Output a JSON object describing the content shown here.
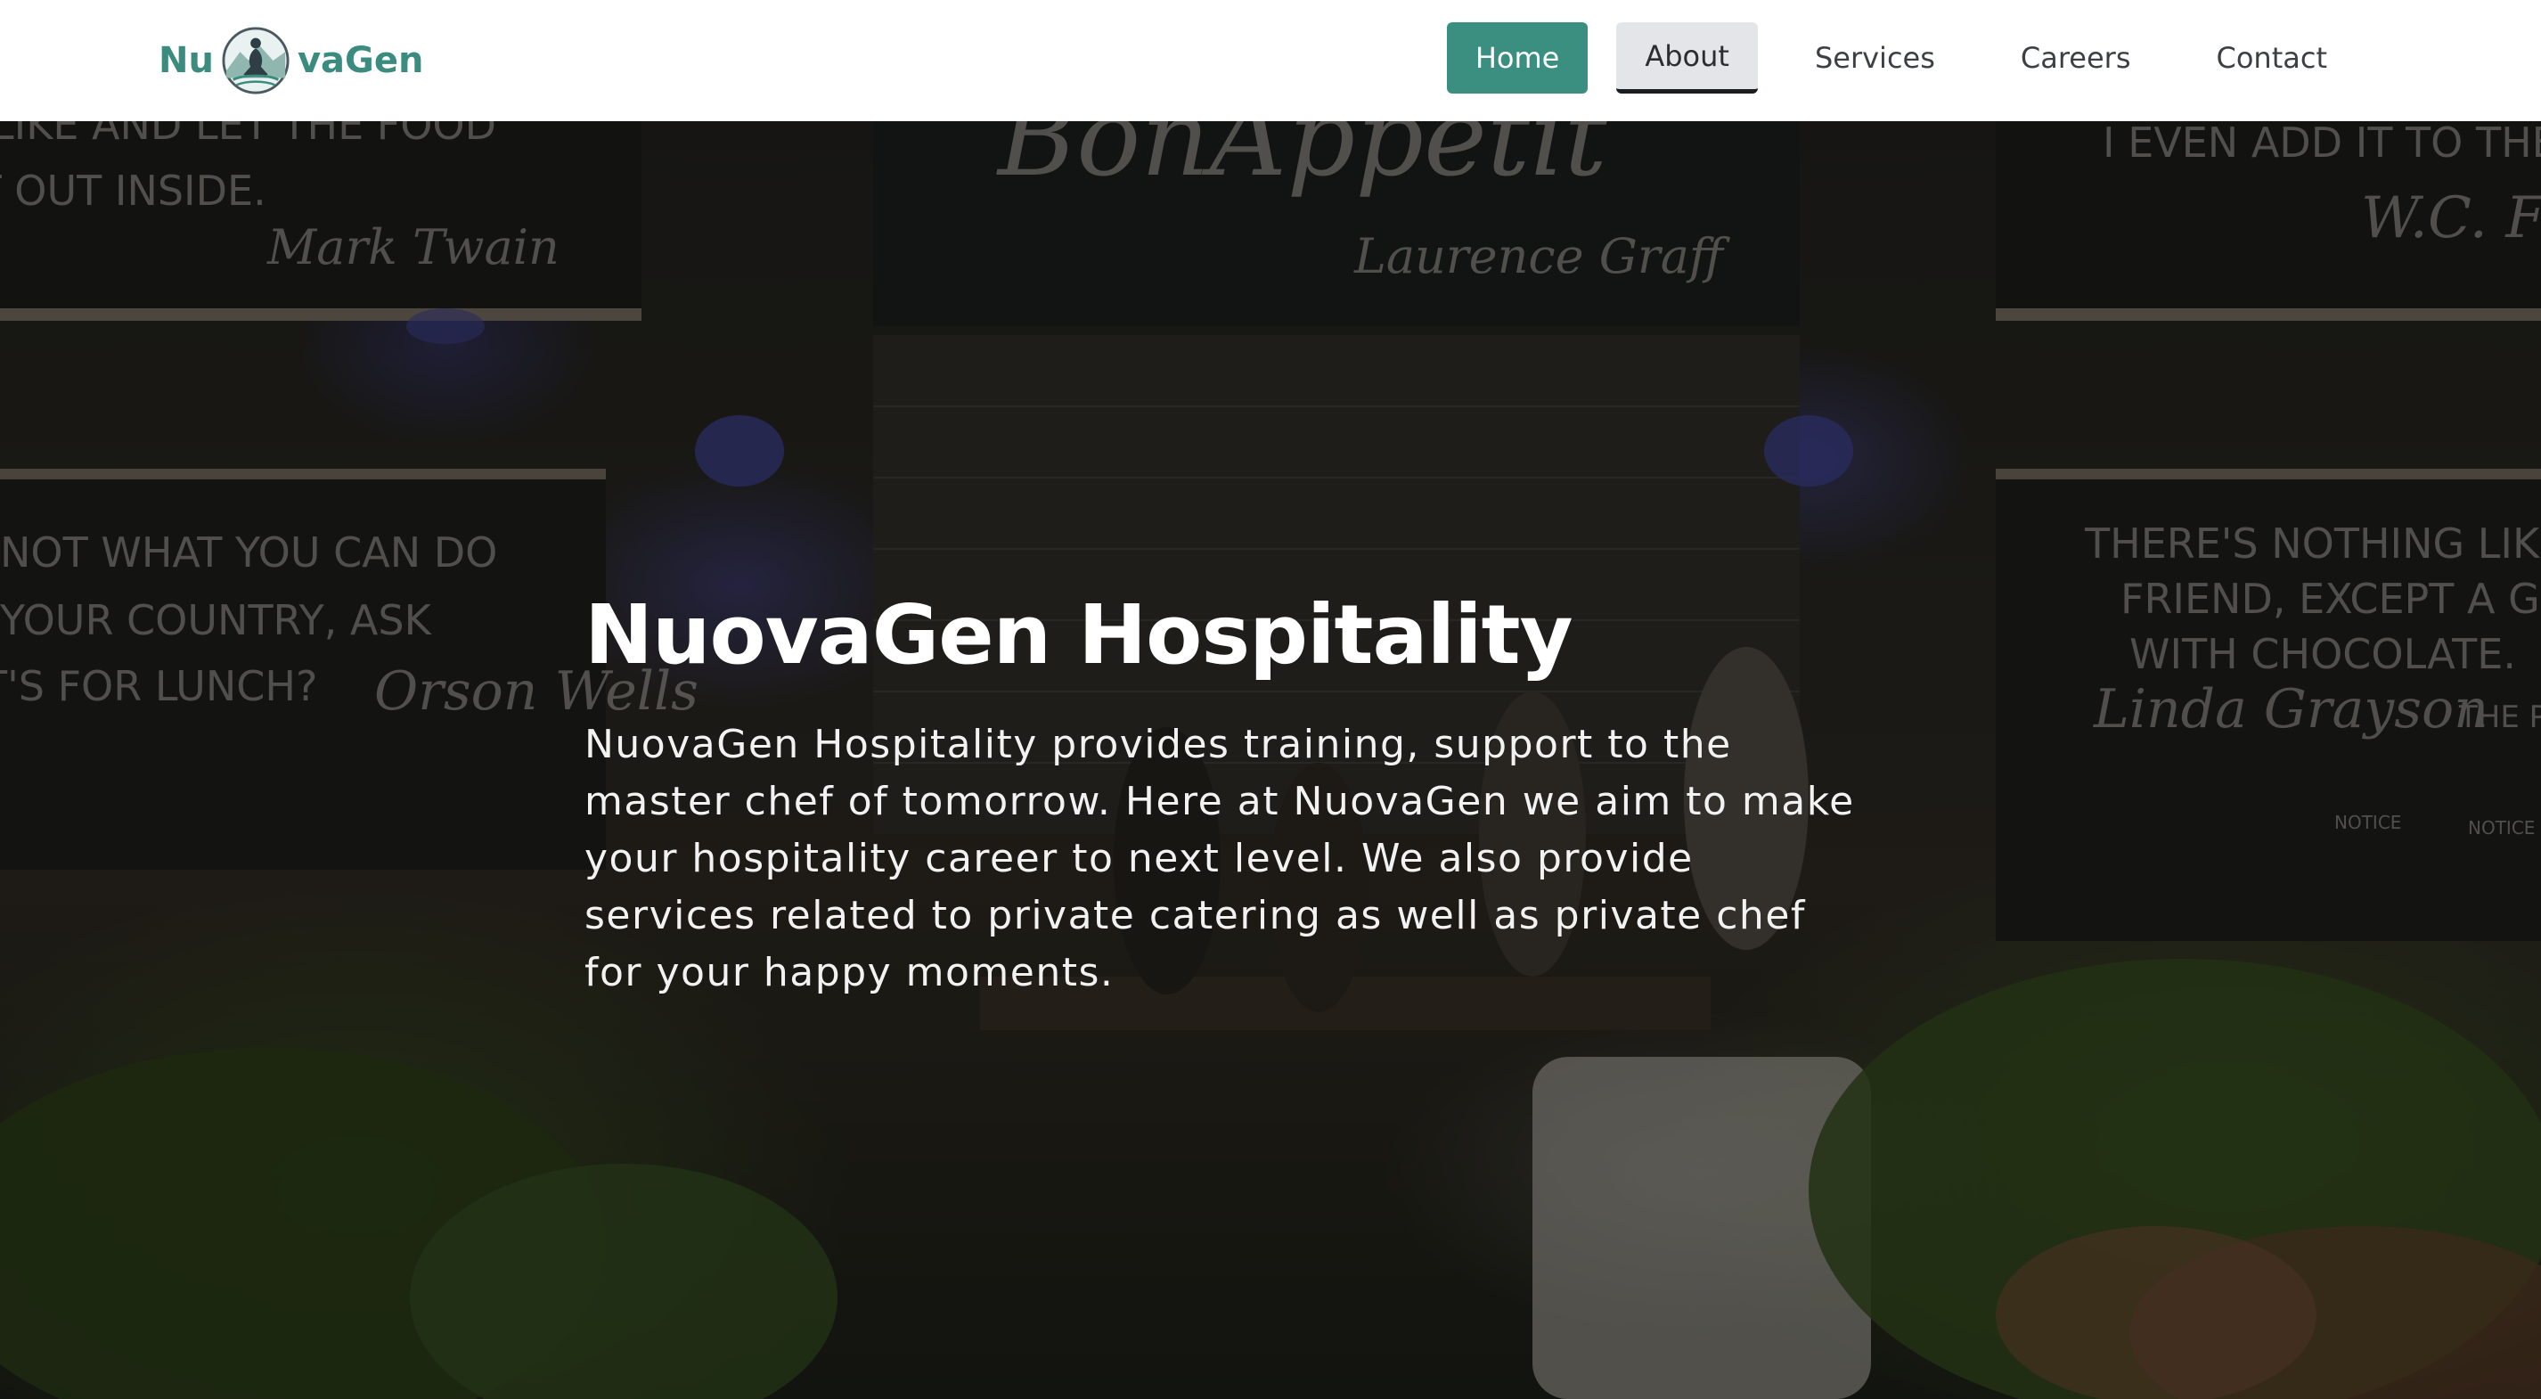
{
  "header": {
    "logo": {
      "text_left": "Nu",
      "text_right": "vaGen",
      "emblem_icon": "meditating-figure-emblem-icon",
      "brand_color": "#3b8c7e"
    },
    "nav": [
      {
        "label": "Home",
        "state": "active"
      },
      {
        "label": "About",
        "state": "hover"
      },
      {
        "label": "Services",
        "state": "default"
      },
      {
        "label": "Careers",
        "state": "default"
      },
      {
        "label": "Contact",
        "state": "default"
      }
    ],
    "colors": {
      "active_bg": "#3b8f80",
      "hover_bg": "#e4e5e8"
    }
  },
  "hero": {
    "title": "NuovaGen Hospitality",
    "description": "NuovaGen Hospitality provides training, support to the master chef of tomorrow. Here at NuovaGen we aim to make your hospitality career to next level. We also provide services related to private catering as well as private chef for your happy moments.",
    "background_icon": "restaurant-kitchen-photo",
    "chalkboard_quotes": [
      "LIKE AND LET THE FOOD",
      "IT OUT INSIDE.",
      "Mark Twain",
      "BonAppetit",
      "Laurence Graff",
      "I EVEN ADD IT TO THE",
      "W.C. F",
      "NOT WHAT YOU CAN DO",
      "YOUR COUNTRY, ASK",
      "T'S FOR LUNCH?",
      "Orson Wells",
      "THERE'S NOTHING LIKE",
      "FRIEND, EXCEPT A GO",
      "WITH CHOCOLATE.",
      "Linda Grayson",
      "THE P",
      "NOTICE",
      "NOTICE"
    ]
  }
}
